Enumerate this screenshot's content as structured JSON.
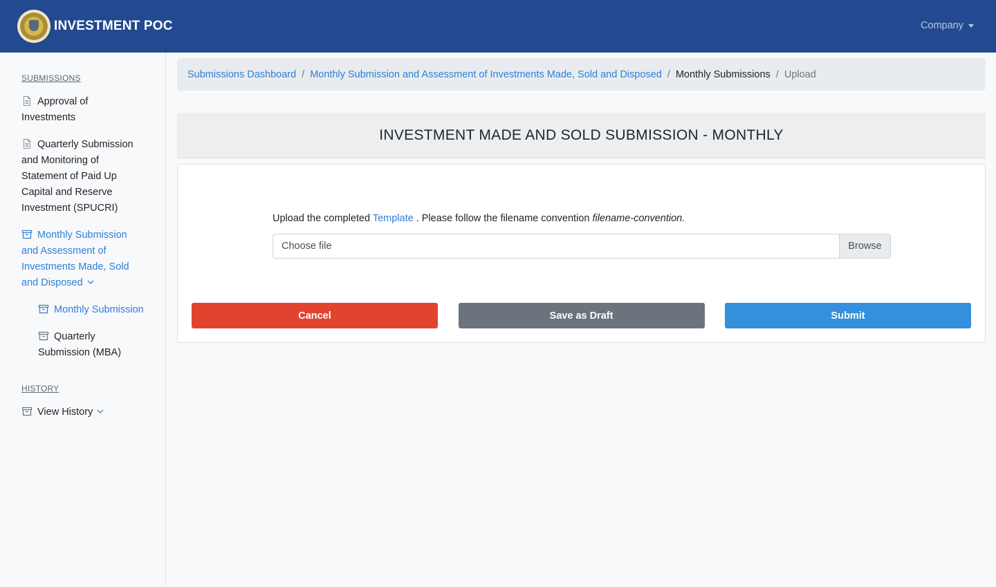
{
  "header": {
    "brand": "INVESTMENT POC",
    "logo_icon": "insurance-commission-seal",
    "company_menu": "Company"
  },
  "sidebar": {
    "submissions_heading": "SUBMISSIONS",
    "items": [
      {
        "label": "Approval of Investments",
        "icon": "document-icon"
      },
      {
        "label": "Quarterly Submission and Monitoring of Statement of Paid Up Capital and Reserve Investment (SPUCRI)",
        "icon": "document-icon"
      },
      {
        "label": "Monthly Submission and Assessment of Investments Made, Sold and Disposed",
        "icon": "archive-icon",
        "active": true
      },
      {
        "label": "Monthly Submission",
        "icon": "archive-icon",
        "active": true
      },
      {
        "label": "Quarterly Submission (MBA)",
        "icon": "archive-icon"
      }
    ],
    "history_heading": "HISTORY",
    "history_items": [
      {
        "label": "View History",
        "icon": "archive-icon"
      }
    ]
  },
  "breadcrumb": {
    "items": [
      "Submissions Dashboard",
      "Monthly Submission and Assessment of Investments Made, Sold and Disposed",
      "Monthly Submissions",
      "Upload"
    ]
  },
  "page": {
    "title": "INVESTMENT MADE AND SOLD SUBMISSION - MONTHLY",
    "upload_prefix": "Upload the completed",
    "template_link": "Template",
    "upload_middle": ". Please follow the filename convention",
    "filename_convention": "filename-convention.",
    "file_placeholder": "Choose file",
    "browse_label": "Browse",
    "cancel_label": "Cancel",
    "draft_label": "Save as Draft",
    "submit_label": "Submit"
  },
  "colors": {
    "navbar": "#234a90",
    "link": "#2f7ed6",
    "cancel": "#e2432f",
    "draft": "#6b737c",
    "submit": "#3490dc"
  }
}
